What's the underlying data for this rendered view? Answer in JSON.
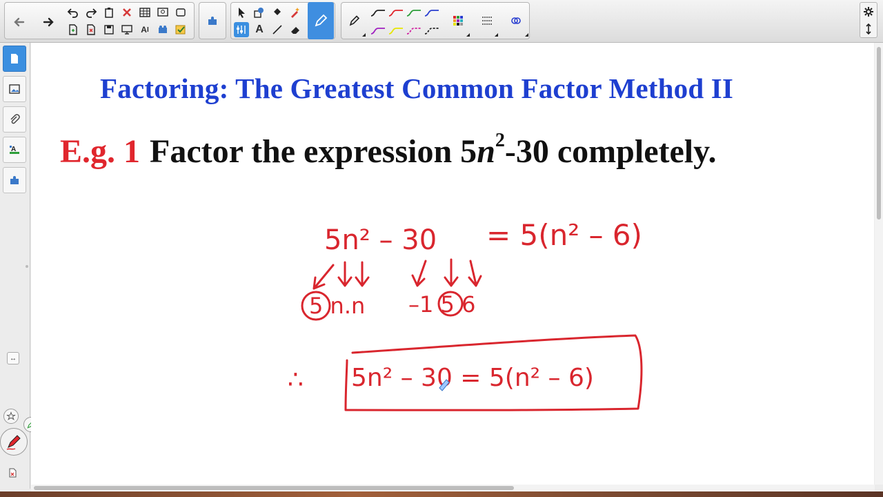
{
  "toolbar": {
    "nav": [
      {
        "name": "back-button",
        "icon": "arrow-left-icon"
      },
      {
        "name": "forward-button",
        "icon": "arrow-right-icon"
      }
    ],
    "pen_colors": [
      "#222222",
      "#e0262d",
      "#2e9e3a",
      "#2a3fd0",
      "#a020c0",
      "#e6e600",
      "#d020a0",
      "#222222"
    ]
  },
  "page": {
    "title": "Factoring: The Greatest Common Factor Method II",
    "example_label": "E.g. 1",
    "problem_prefix": "Factor the expression 5",
    "problem_var": "n",
    "problem_exp": "2",
    "problem_suffix": "-30 completely."
  },
  "ink": {
    "line1_left": "5n² – 30",
    "line1_right": "= 5(n² – 6)",
    "factors_left": "5 n.n",
    "factors_right": "–1 5 6",
    "therefore": "∴",
    "boxed_answer": "5n² – 30 = 5(n² – 6)"
  },
  "colors": {
    "title_blue": "#1e3fd0",
    "label_red": "#e0262d",
    "ink_red": "#d9262e",
    "accent_blue": "#3b8fe0"
  }
}
